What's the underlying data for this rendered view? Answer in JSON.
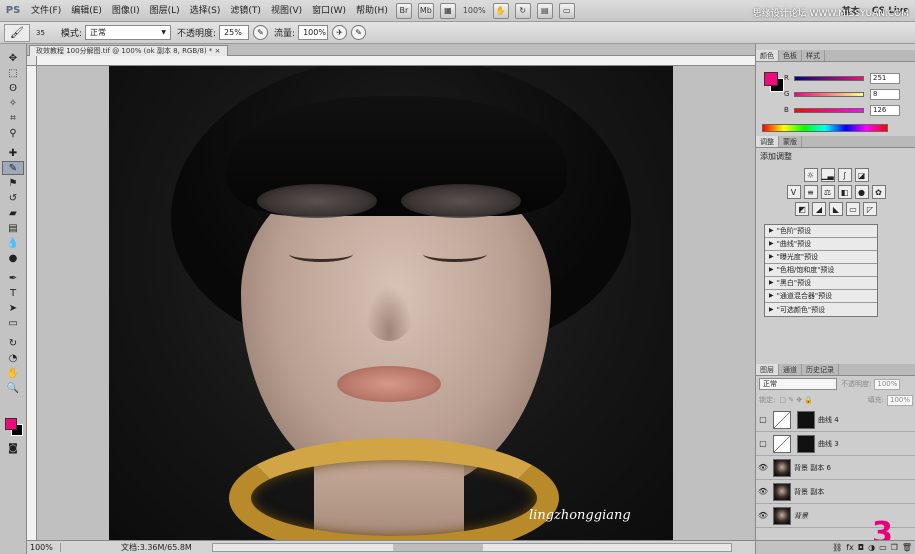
{
  "app": {
    "logo": "PS",
    "menu": [
      "文件(F)",
      "编辑(E)",
      "图像(I)",
      "图层(L)",
      "选择(S)",
      "滤镜(T)",
      "视图(V)",
      "窗口(W)",
      "帮助(H)"
    ],
    "zoom_display": "100%",
    "workspace": "基本",
    "cslive": "CS Live",
    "watermark": "思缘设计论坛 WWW.MISSYUAN.COM"
  },
  "options": {
    "brush_size": "35",
    "mode_label": "模式:",
    "mode_value": "正常",
    "opacity_label": "不透明度:",
    "opacity_value": "25%",
    "flow_label": "流量:",
    "flow_value": "100%"
  },
  "document": {
    "tab_title": "玫效教程 100分解图.tif @ 100% (ok 副本 8, RGB/8) *",
    "signature": "lingzhonggiang",
    "status_zoom": "100%",
    "status_doc": "文档:3.36M/65.8M"
  },
  "colors": {
    "foreground": "#f1097e",
    "background": "#000000",
    "selected_layer": "#8ea2c4"
  },
  "color_panel": {
    "tabs": [
      "颜色",
      "色板",
      "样式"
    ],
    "r": 251,
    "g": 8,
    "b": 126,
    "r_label": "R",
    "g_label": "G",
    "b_label": "B"
  },
  "adjustments": {
    "tabs": [
      "调整",
      "蒙版"
    ],
    "title": "添加调整",
    "presets": [
      "\"色阶\"预设",
      "\"曲线\"预设",
      "\"曝光度\"预设",
      "\"色相/饱和度\"预设",
      "\"黑白\"预设",
      "\"通道混合器\"预设",
      "\"可选颜色\"预设"
    ]
  },
  "layers": {
    "tabs": [
      "图层",
      "通道",
      "历史记录"
    ],
    "blend_mode": "正常",
    "opacity_label": "不透明度:",
    "opacity_value": "100%",
    "lock_label": "锁定:",
    "fill_label": "填充:",
    "fill_value": "100%",
    "items": [
      {
        "name": "曲线 4",
        "visible": false
      },
      {
        "name": "曲线 3",
        "visible": false
      },
      {
        "name": "背景 副本 6",
        "visible": true
      },
      {
        "name": "背景 副本",
        "visible": true
      },
      {
        "name": "背景",
        "visible": true
      }
    ],
    "step_number": "3"
  }
}
